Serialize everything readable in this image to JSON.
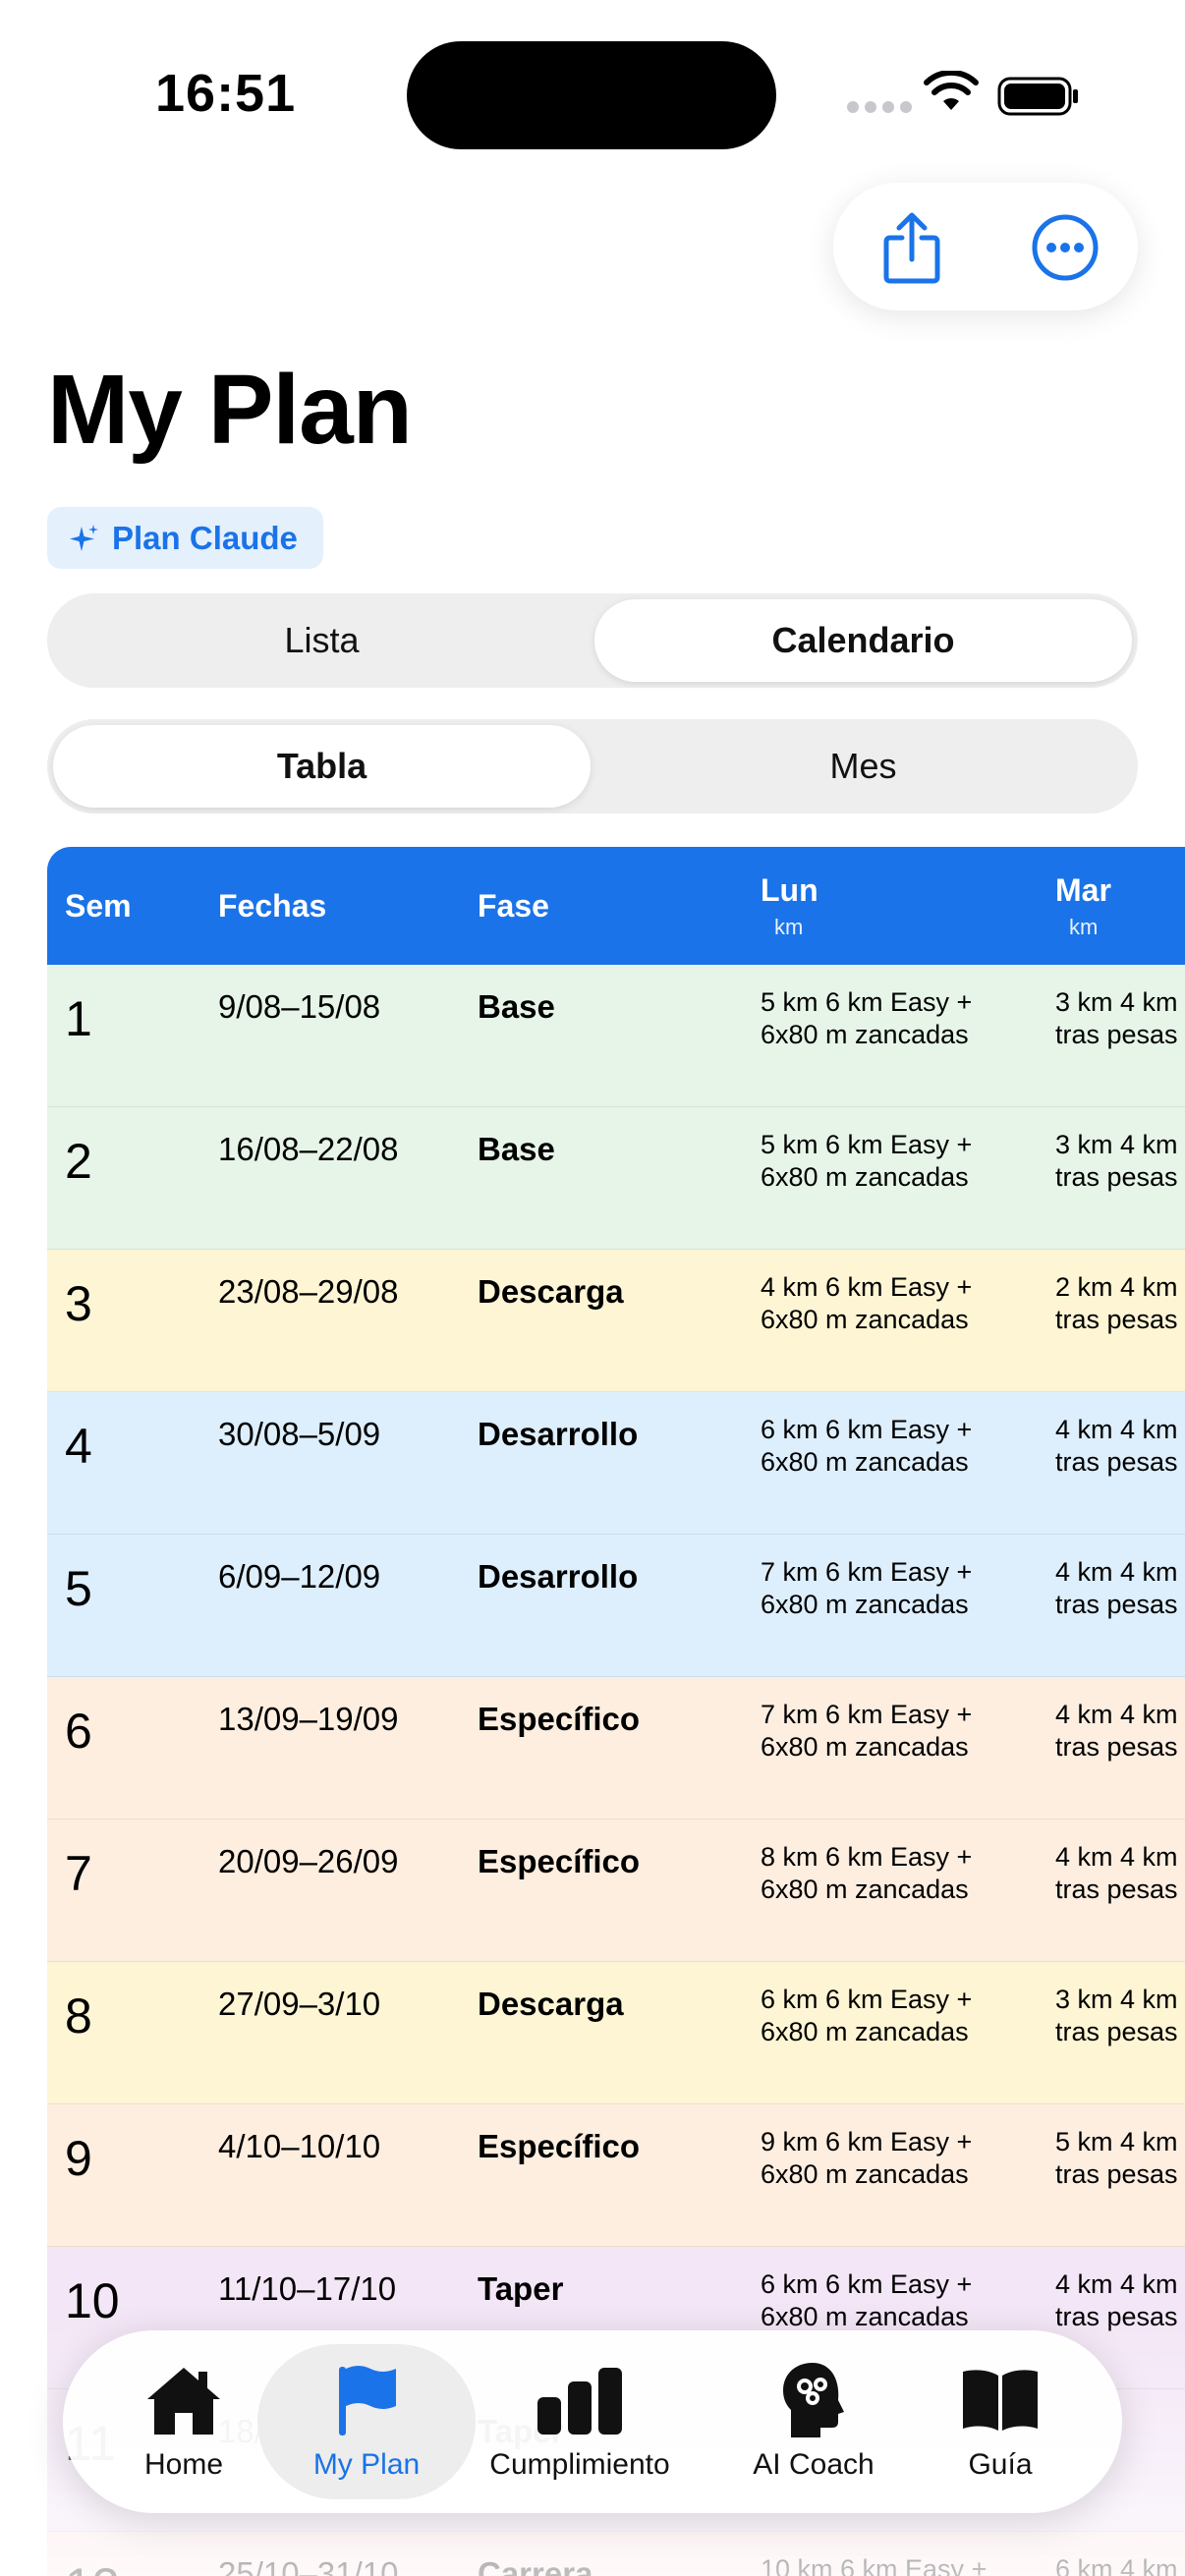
{
  "status_bar": {
    "time": "16:51"
  },
  "page": {
    "title": "My Plan",
    "plan_badge": "Plan Claude"
  },
  "view_mode": {
    "options": [
      "Lista",
      "Calendario"
    ],
    "selected": "Calendario"
  },
  "calendar_mode": {
    "options": [
      "Tabla",
      "Mes"
    ],
    "selected": "Tabla"
  },
  "table": {
    "columns": [
      {
        "label": "Sem",
        "unit": ""
      },
      {
        "label": "Fechas",
        "unit": ""
      },
      {
        "label": "Fase",
        "unit": ""
      },
      {
        "label": "Lun",
        "unit": "km"
      },
      {
        "label": "Mar",
        "unit": "km"
      }
    ],
    "phase_colors": {
      "Base": "#e6f5e8",
      "Descarga": "#fdf5d4",
      "Desarrollo": "#ddeefc",
      "Específico": "#fdeee0",
      "Taper": "#f3e6f6",
      "Carrera": "#fde7ea"
    },
    "rows": [
      {
        "sem": "1",
        "dates": "9/08–15/08",
        "phase": "Base",
        "mon": [
          "5 km 6 km Easy +",
          "6x80 m zancadas"
        ],
        "tue": [
          "3 km 4 km",
          "tras pesas"
        ]
      },
      {
        "sem": "2",
        "dates": "16/08–22/08",
        "phase": "Base",
        "mon": [
          "5 km 6 km Easy +",
          "6x80 m zancadas"
        ],
        "tue": [
          "3 km 4 km",
          "tras pesas"
        ]
      },
      {
        "sem": "3",
        "dates": "23/08–29/08",
        "phase": "Descarga",
        "mon": [
          "4 km 6 km Easy +",
          "6x80 m zancadas"
        ],
        "tue": [
          "2 km 4 km",
          "tras pesas"
        ]
      },
      {
        "sem": "4",
        "dates": "30/08–5/09",
        "phase": "Desarrollo",
        "mon": [
          "6 km 6 km Easy +",
          "6x80 m zancadas"
        ],
        "tue": [
          "4 km 4 km",
          "tras pesas"
        ]
      },
      {
        "sem": "5",
        "dates": "6/09–12/09",
        "phase": "Desarrollo",
        "mon": [
          "7 km 6 km Easy +",
          "6x80 m zancadas"
        ],
        "tue": [
          "4 km 4 km",
          "tras pesas"
        ]
      },
      {
        "sem": "6",
        "dates": "13/09–19/09",
        "phase": "Específico",
        "mon": [
          "7 km 6 km Easy +",
          "6x80 m zancadas"
        ],
        "tue": [
          "4 km 4 km",
          "tras pesas"
        ]
      },
      {
        "sem": "7",
        "dates": "20/09–26/09",
        "phase": "Específico",
        "mon": [
          "8 km 6 km Easy +",
          "6x80 m zancadas"
        ],
        "tue": [
          "4 km 4 km",
          "tras pesas"
        ]
      },
      {
        "sem": "8",
        "dates": "27/09–3/10",
        "phase": "Descarga",
        "mon": [
          "6 km 6 km Easy +",
          "6x80 m zancadas"
        ],
        "tue": [
          "3 km 4 km",
          "tras pesas"
        ]
      },
      {
        "sem": "9",
        "dates": "4/10–10/10",
        "phase": "Específico",
        "mon": [
          "9 km 6 km Easy +",
          "6x80 m zancadas"
        ],
        "tue": [
          "5 km 4 km",
          "tras pesas"
        ]
      },
      {
        "sem": "10",
        "dates": "11/10–17/10",
        "phase": "Taper",
        "mon": [
          "6 km 6 km Easy +",
          "6x80 m zancadas"
        ],
        "tue": [
          "4 km 4 km",
          "tras pesas"
        ]
      },
      {
        "sem": "11",
        "dates": "18/10–24/10",
        "phase": "Taper",
        "mon": [
          "",
          ""
        ],
        "tue": [
          "",
          ""
        ]
      },
      {
        "sem": "12",
        "dates": "25/10–31/10",
        "phase": "Carrera",
        "mon": [
          "10 km 6 km Easy +",
          ""
        ],
        "tue": [
          "6 km 4 km",
          ""
        ]
      }
    ]
  },
  "tabbar": {
    "items": [
      {
        "label": "Home",
        "icon": "house-icon"
      },
      {
        "label": "My Plan",
        "icon": "flag-icon"
      },
      {
        "label": "Cumplimiento",
        "icon": "bar-chart-icon"
      },
      {
        "label": "AI Coach",
        "icon": "brain-head-icon"
      },
      {
        "label": "Guía",
        "icon": "book-icon"
      }
    ],
    "active": "My Plan"
  },
  "colors": {
    "accent": "#1a73e8",
    "header": "#1a73e8"
  }
}
